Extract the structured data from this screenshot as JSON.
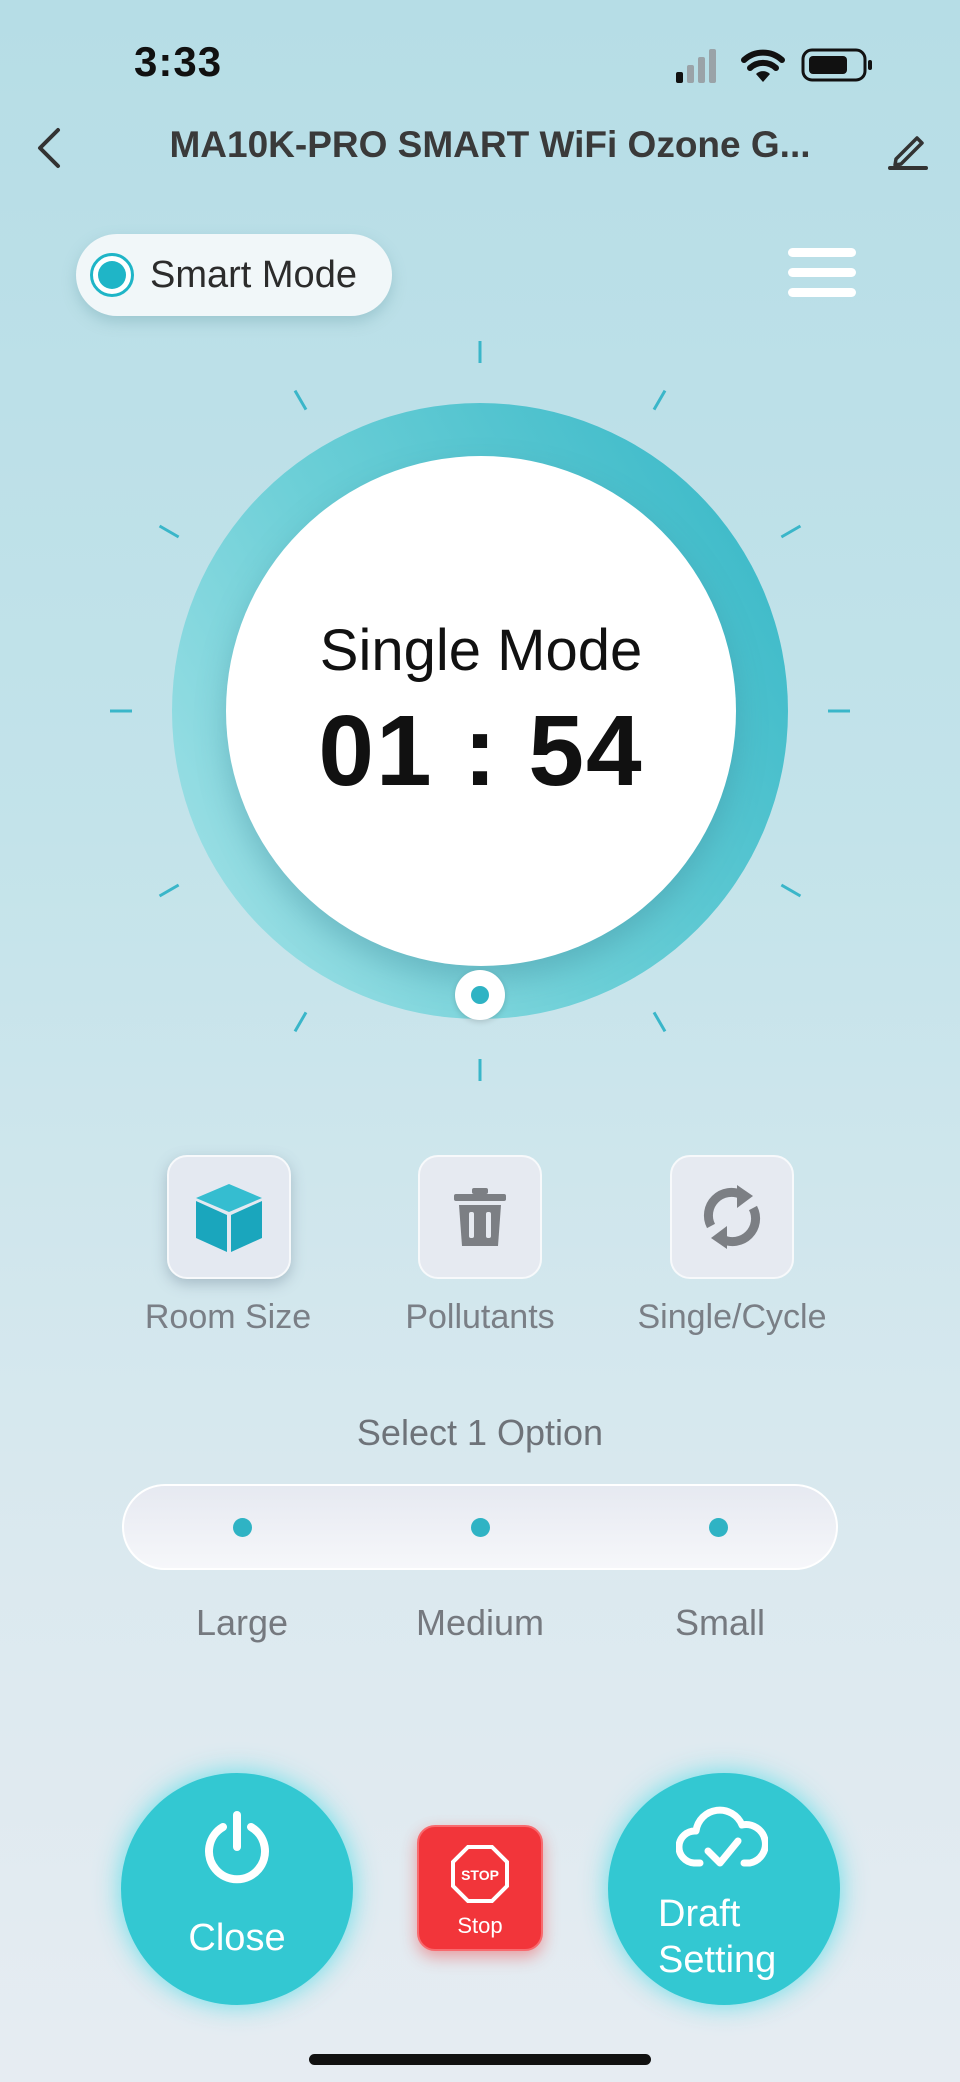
{
  "status_bar": {
    "time": "3:33"
  },
  "header": {
    "title": "MA10K-PRO SMART WiFi Ozone G..."
  },
  "mode_selector": {
    "label": "Smart Mode"
  },
  "dial": {
    "mode": "Single Mode",
    "time": "01 : 54"
  },
  "options": [
    {
      "label": "Room Size",
      "icon": "cube-icon",
      "active": true
    },
    {
      "label": "Pollutants",
      "icon": "trash-icon",
      "active": false
    },
    {
      "label": "Single/Cycle",
      "icon": "cycle-icon",
      "active": false
    }
  ],
  "size_selector": {
    "prompt": "Select 1 Option",
    "choices": [
      "Large",
      "Medium",
      "Small"
    ]
  },
  "actions": {
    "close_label": "Close",
    "stop_sign": "STOP",
    "stop_label": "Stop",
    "draft_line1": "Draft",
    "draft_line2": "Setting"
  },
  "colors": {
    "accent": "#2fb3c4",
    "button": "#33c8d2",
    "stop": "#f2353a"
  }
}
